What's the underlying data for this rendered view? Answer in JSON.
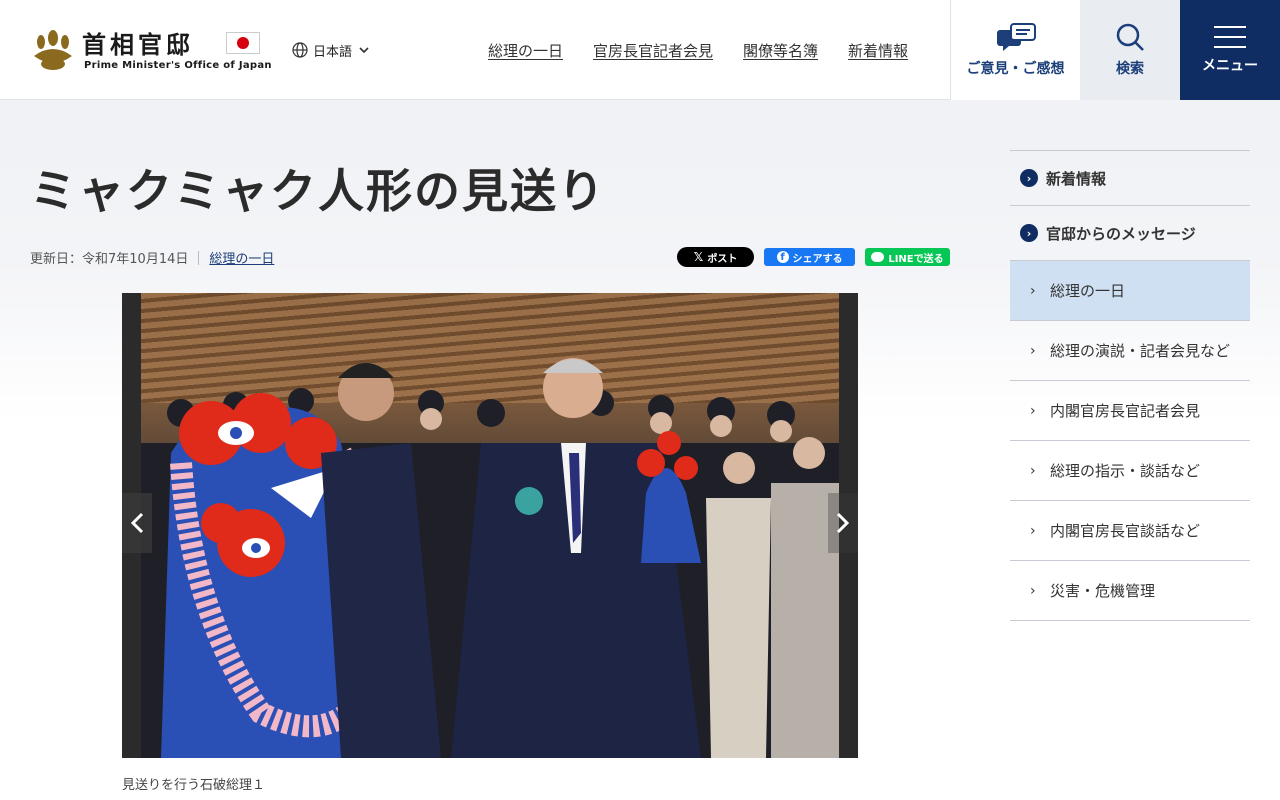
{
  "header": {
    "logo_title": "首相官邸",
    "logo_subtitle": "Prime Minister's Office of Japan",
    "language": "日本語",
    "nav": [
      "総理の一日",
      "官房長官記者会見",
      "閣僚等名簿",
      "新着情報"
    ],
    "feedback_label": "ご意見・ご感想",
    "search_label": "検索",
    "menu_label": "メニュー"
  },
  "article": {
    "title": "ミャクミャク人形の見送り",
    "updated": "更新日：令和7年10月14日",
    "category": "総理の一日",
    "share": {
      "x": "ポスト",
      "facebook": "シェアする",
      "line": "LINEで送る"
    },
    "caption": "見送りを行う石破総理１"
  },
  "sidebar": {
    "top_items": [
      "新着情報",
      "官邸からのメッセージ"
    ],
    "sub_items": [
      "総理の一日",
      "総理の演説・記者会見など",
      "内閣官房長官記者会見",
      "総理の指示・談話など",
      "内閣官房長官談話など",
      "災害・危機管理"
    ],
    "active": "総理の一日"
  },
  "colors": {
    "brand_navy": "#0f2d63",
    "active_bg": "#cfe0f3",
    "flag_red": "#d7000f"
  }
}
